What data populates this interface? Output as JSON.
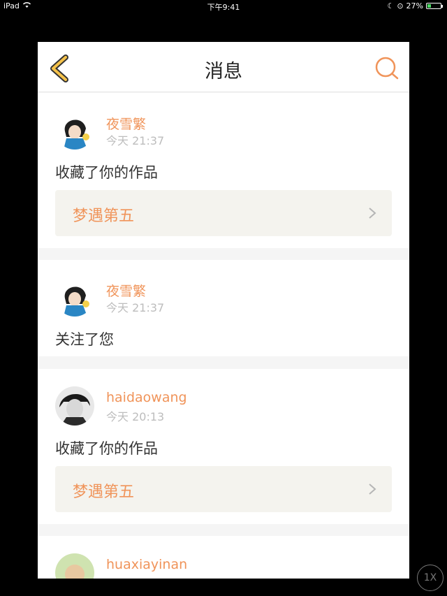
{
  "statusbar": {
    "device": "iPad",
    "time": "下午9:41",
    "battery": "27%",
    "battery_level": 0.27
  },
  "navbar": {
    "title": "消息"
  },
  "colors": {
    "accent": "#f0945a",
    "back": "#f5c24a",
    "card_bg": "#f4f3ee"
  },
  "messages": [
    {
      "user": "夜雪繁",
      "time": "今天 21:37",
      "action": "收藏了你的作品",
      "work": "梦遇第五"
    },
    {
      "user": "夜雪繁",
      "time": "今天 21:37",
      "action": "关注了您"
    },
    {
      "user": "haidaowang",
      "time": "今天 20:13",
      "action": "收藏了你的作品",
      "work": "梦遇第五"
    },
    {
      "user": "huaxiayinan"
    }
  ],
  "zoom_button": {
    "label": "1X"
  }
}
